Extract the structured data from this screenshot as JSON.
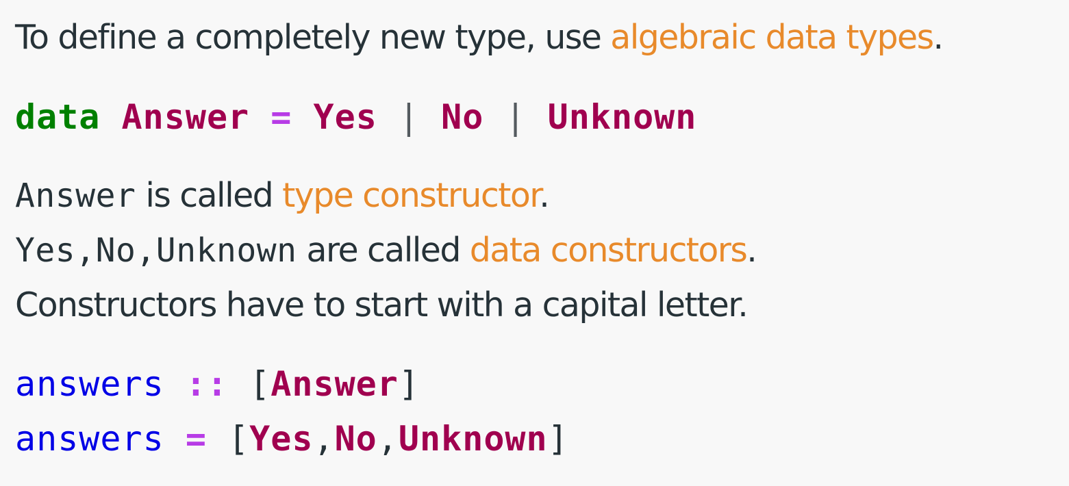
{
  "intro": {
    "text_before": "To define a completely new type, use ",
    "link": "algebraic data types",
    "text_after": "."
  },
  "code1": {
    "keyword": "data",
    "type_name": "Answer",
    "equals": "=",
    "ctor1": "Yes",
    "pipe1": "|",
    "ctor2": "No",
    "pipe2": "|",
    "ctor3": "Unknown"
  },
  "explain": {
    "line1_code": "Answer",
    "line1_text": " is called ",
    "line1_link": "type constructor",
    "line1_end": ".",
    "line2_code": "Yes,No,Unknown",
    "line2_text": " are called ",
    "line2_link": "data constructors",
    "line2_end": ".",
    "line3": "Constructors have to start with a capital letter."
  },
  "code2": {
    "sig_name": "answers",
    "sig_op": "::",
    "sig_open": "[",
    "sig_type": "Answer",
    "sig_close": "]",
    "def_name": "answers",
    "def_op": "=",
    "def_open": "[",
    "def_v1": "Yes",
    "def_comma1": ",",
    "def_v2": "No",
    "def_comma2": ",",
    "def_v3": "Unknown",
    "def_close": "]"
  },
  "colors": {
    "background": "#f8f8f8",
    "text": "#263238",
    "link": "#e88a2b",
    "keyword": "#008000",
    "constructor": "#a0004f",
    "operator": "#b73ce6",
    "function_name": "#0000e6"
  }
}
